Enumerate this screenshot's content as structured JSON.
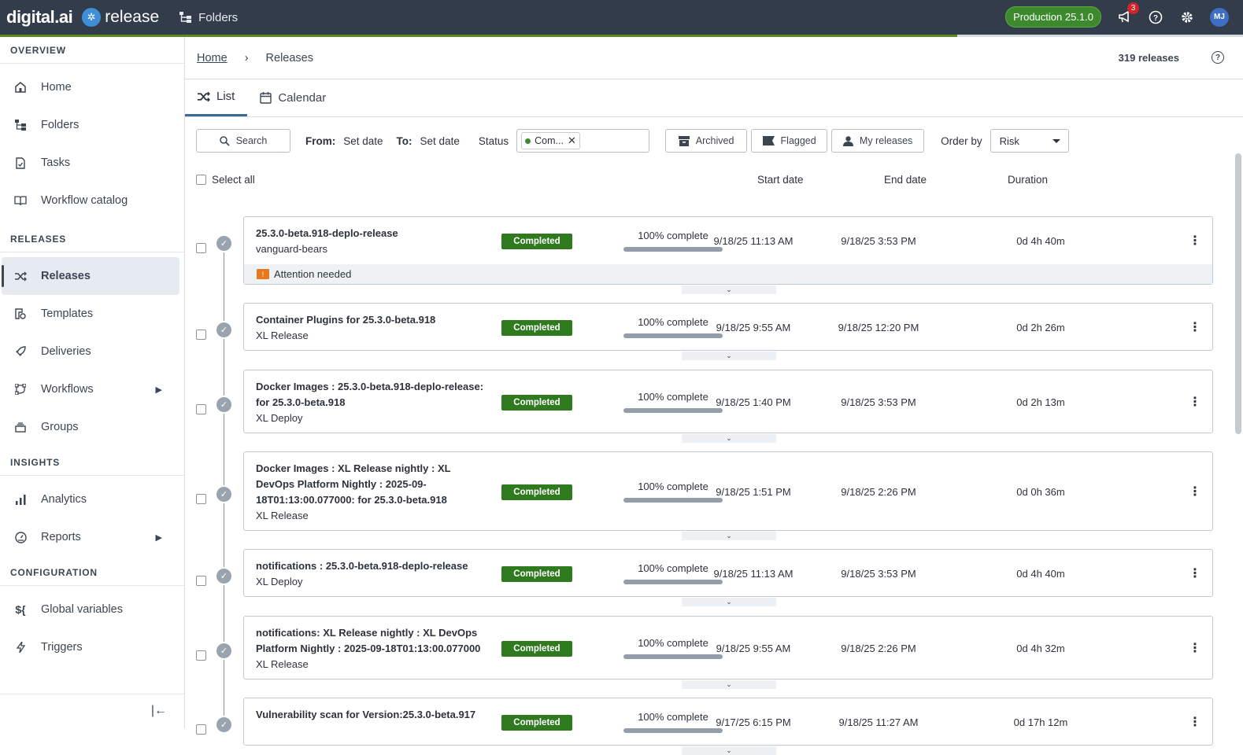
{
  "topbar": {
    "brand": "digital.ai",
    "product": "release",
    "nav_label": "Folders",
    "environment": "Production 25.1.0",
    "notification_count": "3",
    "user_initials": "MJ",
    "load_progress": 0.77
  },
  "sidebar": {
    "sections": {
      "overview": "OVERVIEW",
      "releases": "RELEASES",
      "insights": "INSIGHTS",
      "configuration": "CONFIGURATION"
    },
    "items": {
      "home": "Home",
      "folders": "Folders",
      "tasks": "Tasks",
      "workflow_catalog": "Workflow catalog",
      "releases": "Releases",
      "templates": "Templates",
      "deliveries": "Deliveries",
      "workflows": "Workflows",
      "groups": "Groups",
      "analytics": "Analytics",
      "reports": "Reports",
      "global_variables": "Global variables",
      "triggers": "Triggers"
    }
  },
  "breadcrumb": {
    "home": "Home",
    "current": "Releases",
    "count": "319 releases"
  },
  "tabs": {
    "list": "List",
    "calendar": "Calendar"
  },
  "filters": {
    "search": "Search",
    "from_label": "From:",
    "from_value": "Set date",
    "to_label": "To:",
    "to_value": "Set date",
    "status_label": "Status",
    "status_chip": "Com...",
    "archived": "Archived",
    "flagged": "Flagged",
    "my_releases": "My releases",
    "order_by_label": "Order by",
    "order_by_value": "Risk"
  },
  "list_header": {
    "select_all": "Select all",
    "start_date": "Start date",
    "end_date": "End date",
    "duration": "Duration"
  },
  "releases": [
    {
      "title": "25.3.0-beta.918-deplo-release",
      "subtitle": "vanguard-bears",
      "status": "Completed",
      "progress": "100% complete",
      "start": "9/18/25 11:13 AM",
      "end": "9/18/25 3:53 PM",
      "duration": "0d 4h 40m",
      "attention": "Attention needed"
    },
    {
      "title": "Container Plugins for 25.3.0-beta.918",
      "subtitle": "XL Release",
      "status": "Completed",
      "progress": "100% complete",
      "start": "9/18/25 9:55 AM",
      "end": "9/18/25 12:20 PM",
      "duration": "0d 2h 26m"
    },
    {
      "title": "Docker Images : 25.3.0-beta.918-deplo-release: for 25.3.0-beta.918",
      "subtitle": "XL Deploy",
      "status": "Completed",
      "progress": "100% complete",
      "start": "9/18/25 1:40 PM",
      "end": "9/18/25 3:53 PM",
      "duration": "0d 2h 13m"
    },
    {
      "title": "Docker Images : XL Release nightly : XL DevOps Platform Nightly : 2025-09-18T01:13:00.077000: for 25.3.0-beta.918",
      "subtitle": "XL Release",
      "status": "Completed",
      "progress": "100% complete",
      "start": "9/18/25 1:51 PM",
      "end": "9/18/25 2:26 PM",
      "duration": "0d 0h 36m"
    },
    {
      "title": "notifications : 25.3.0-beta.918-deplo-release",
      "subtitle": "XL Deploy",
      "status": "Completed",
      "progress": "100% complete",
      "start": "9/18/25 11:13 AM",
      "end": "9/18/25 3:53 PM",
      "duration": "0d 4h 40m"
    },
    {
      "title": "notifications: XL Release nightly : XL DevOps Platform Nightly : 2025-09-18T01:13:00.077000",
      "subtitle": "XL Release",
      "status": "Completed",
      "progress": "100% complete",
      "start": "9/18/25 9:55 AM",
      "end": "9/18/25 2:26 PM",
      "duration": "0d 4h 32m"
    },
    {
      "title": "Vulnerability scan for Version:25.3.0-beta.917",
      "subtitle": "",
      "status": "Completed",
      "progress": "100% complete",
      "start": "9/17/25 6:15 PM",
      "end": "9/18/25 11:27 AM",
      "duration": "0d 17h 12m"
    }
  ]
}
